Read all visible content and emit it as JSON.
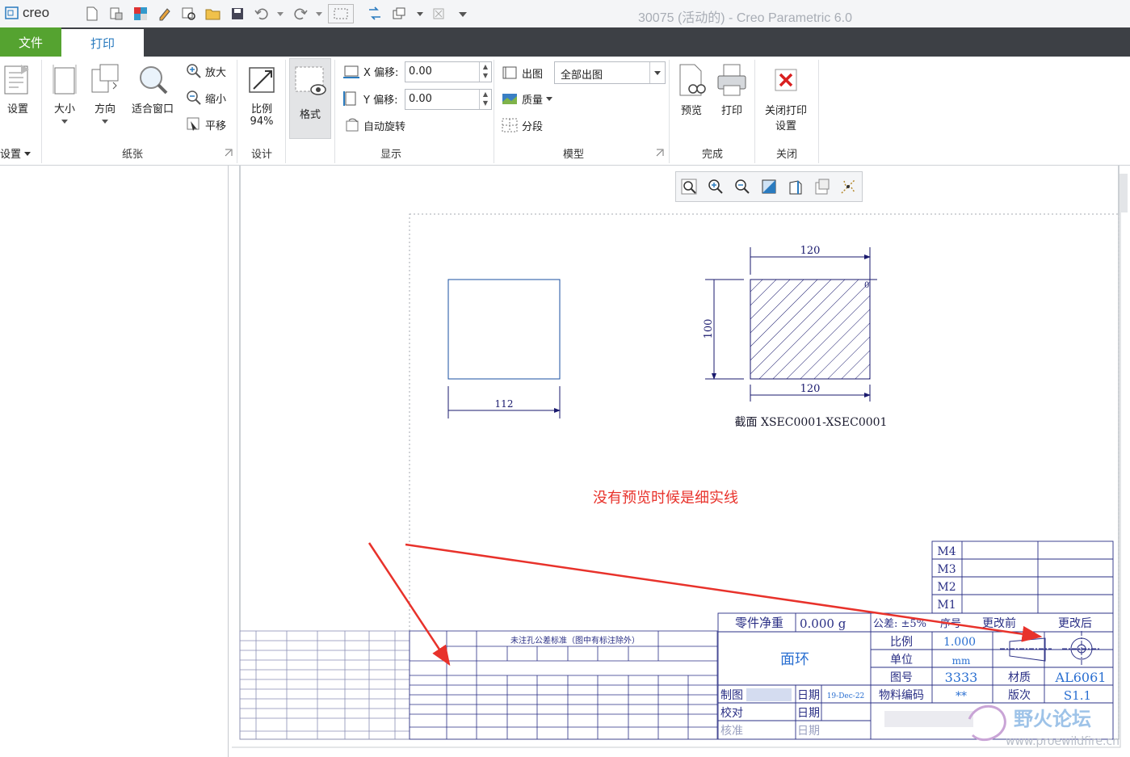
{
  "titlebar": {
    "logo_text": "creo",
    "title": "30075 (活动的) - Creo Parametric 6.0"
  },
  "tabs": {
    "file": "文件",
    "print": "打印"
  },
  "ribbon": {
    "setup": {
      "button": "设置",
      "group": "设置"
    },
    "paper": {
      "size": "大小",
      "orientation": "方向",
      "fit_window": "适合窗口",
      "zoom_in": "放大",
      "zoom_out": "缩小",
      "pan": "平移",
      "group": "纸张"
    },
    "design": {
      "scale_label": "比例",
      "scale_value": "94%",
      "group": "设计"
    },
    "format": {
      "button": "格式"
    },
    "display": {
      "x_offset_label": "X 偏移:",
      "x_offset_value": "0.00",
      "y_offset_label": "Y 偏移:",
      "y_offset_value": "0.00",
      "auto_rotate": "自动旋转",
      "group": "显示"
    },
    "model": {
      "plot_label": "出图",
      "plot_value": "全部出图",
      "quality": "质量",
      "segment": "分段",
      "group": "模型"
    },
    "finish": {
      "preview": "预览",
      "print": "打印",
      "group": "完成"
    },
    "close": {
      "line1": "关闭打印",
      "line2": "设置",
      "group": "关闭"
    }
  },
  "drawing": {
    "dim_top": "120",
    "dim_bottom": "120",
    "dim_left": "100",
    "dim_small_square": "112",
    "dim_zero": "0",
    "section_label": "截面 XSEC0001-XSEC0001",
    "annotation": "没有预览时候是细实线",
    "tolerance_title": "未注孔公差标准（图中有标注除外）",
    "title_block": {
      "part_weight_label": "零件净重",
      "part_weight_value": "0.000 g",
      "part_name": "面环",
      "tolerance_label": "公差: ±5%",
      "revision_no": "序号",
      "before_change": "更改前",
      "after_change": "更改后",
      "m4": "M4",
      "m3": "M3",
      "m2": "M2",
      "m1": "M1",
      "scale_label": "比例",
      "scale_value": "1.000",
      "unit_label": "单位",
      "unit_value": "mm",
      "drawing_no_label": "图号",
      "drawing_no_value": "3333",
      "material_label": "材质",
      "material_value": "AL6061",
      "drafter_label": "制图",
      "date_label": "日期",
      "date_value": "19-Dec-22",
      "material_code_label": "物料编码",
      "material_code_value": "**",
      "version_label": "版次",
      "version_value": "S1.1",
      "check_label": "校对",
      "date_label2": "日期",
      "approve_label": "核准",
      "date_label3": "日期"
    },
    "watermark": {
      "name": "野火论坛",
      "url": "www.proewildfire.cn"
    }
  },
  "colors": {
    "tab_file_bg": "#55a330",
    "tab_bar_bg": "#3d4045",
    "drawing_line": "#1a1a6e",
    "annotation_red": "#e8322b",
    "accent_blue": "#2a7bbf"
  }
}
